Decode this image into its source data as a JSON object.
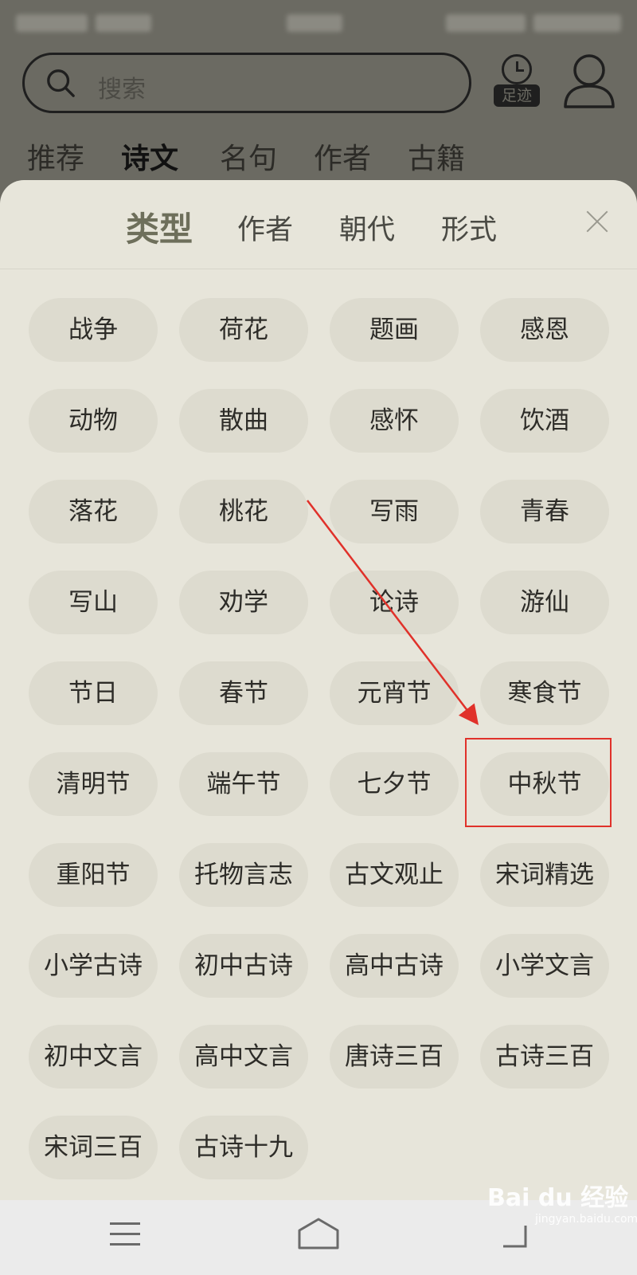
{
  "search": {
    "placeholder": "搜索"
  },
  "history": {
    "label": "足迹"
  },
  "nav_tabs": [
    "推荐",
    "诗文",
    "名句",
    "作者",
    "古籍"
  ],
  "sheet": {
    "tabs": [
      "类型",
      "作者",
      "朝代",
      "形式"
    ],
    "chips": [
      "战争",
      "荷花",
      "题画",
      "感恩",
      "动物",
      "散曲",
      "感怀",
      "饮酒",
      "落花",
      "桃花",
      "写雨",
      "青春",
      "写山",
      "劝学",
      "论诗",
      "游仙",
      "节日",
      "春节",
      "元宵节",
      "寒食节",
      "清明节",
      "端午节",
      "七夕节",
      "中秋节",
      "重阳节",
      "托物言志",
      "古文观止",
      "宋词精选",
      "小学古诗",
      "初中古诗",
      "高中古诗",
      "小学文言",
      "初中文言",
      "高中文言",
      "唐诗三百",
      "古诗三百",
      "宋词三百",
      "古诗十九"
    ]
  },
  "watermark": {
    "brand": "Bai du 经验",
    "url": "jingyan.baidu.com"
  },
  "colors": {
    "highlight": "#e0312a",
    "sheet_bg": "#e7e5da",
    "chip_bg": "#dddbcf"
  }
}
